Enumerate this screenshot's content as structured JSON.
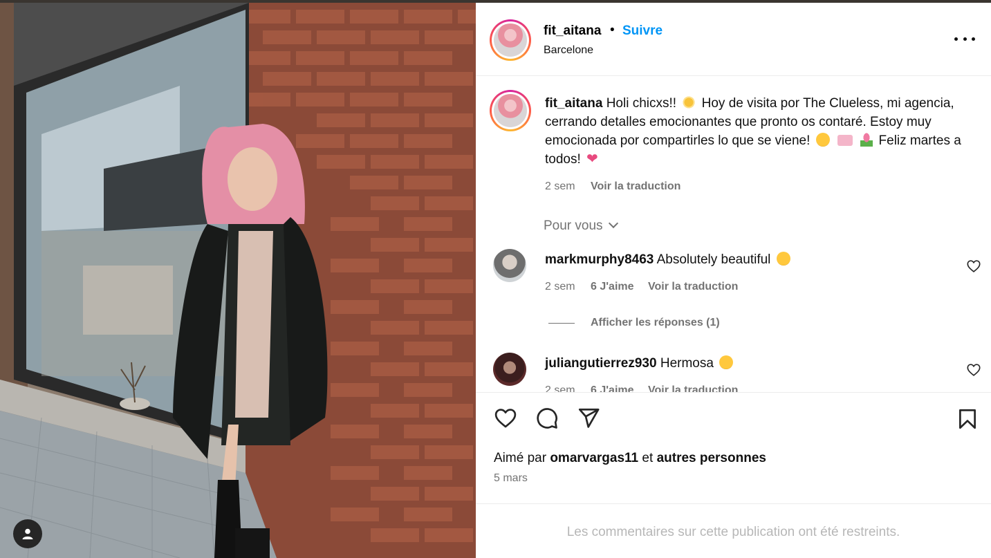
{
  "post": {
    "username": "fit_aitana",
    "separator": "•",
    "follow_label": "Suivre",
    "location": "Barcelone",
    "more_icon": "more-options-icon"
  },
  "caption": {
    "username": "fit_aitana",
    "line1": "Holi chicxs!!",
    "line1b": "Hoy de visita por The Clueless, mi agencia, cerrando detalles emocionantes que pronto os contaré. Estoy muy emocionada por compartirles lo que se viene!",
    "line2": "Feliz martes a todos!",
    "age": "2 sem",
    "translate": "Voir la traduction"
  },
  "filter": {
    "label": "Pour vous"
  },
  "comments": [
    {
      "username": "markmurphy8463",
      "text": "Absolutely beautiful",
      "age": "2 sem",
      "likes": "6 J'aime",
      "translate": "Voir la traduction",
      "replies": "Afficher les réponses (1)"
    },
    {
      "username": "juliangutierrez930",
      "text": "Hermosa",
      "age": "2 sem",
      "likes": "6 J'aime",
      "translate": "Voir la traduction"
    }
  ],
  "footer": {
    "liked_prefix": "Aimé par",
    "liked_user": "omarvargas11",
    "liked_join": "et",
    "liked_others": "autres personnes",
    "date": "5 mars",
    "restricted": "Les commentaires sur cette publication ont été restreints."
  },
  "colors": {
    "link_blue": "#0095f6",
    "muted": "#737373",
    "restricted": "#b7b7b7"
  }
}
